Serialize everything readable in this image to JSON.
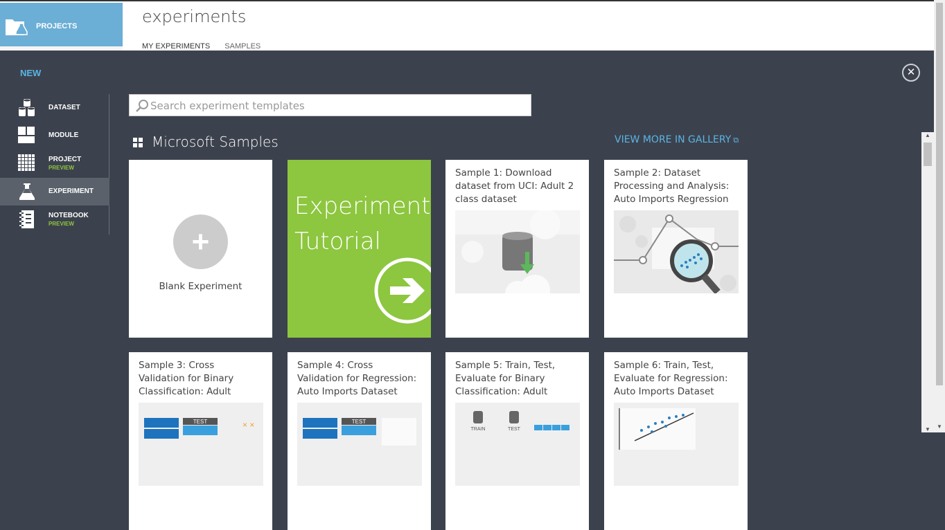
{
  "app": {
    "tile_label": "PROJECTS",
    "page_title": "experiments",
    "tabs": [
      {
        "label": "MY EXPERIMENTS"
      },
      {
        "label": "SAMPLES"
      }
    ]
  },
  "overlay": {
    "new_label": "NEW",
    "close_glyph": "✕",
    "nav": [
      {
        "label": "DATASET",
        "sub": "",
        "icon": "dataset-icon"
      },
      {
        "label": "MODULE",
        "sub": "",
        "icon": "module-icon"
      },
      {
        "label": "PROJECT",
        "sub": "PREVIEW",
        "icon": "project-grid-icon"
      },
      {
        "label": "EXPERIMENT",
        "sub": "",
        "icon": "flask-icon",
        "active": true
      },
      {
        "label": "NOTEBOOK",
        "sub": "PREVIEW",
        "icon": "notebook-icon"
      }
    ],
    "search": {
      "placeholder": "Search experiment templates",
      "value": ""
    },
    "section_title": "Microsoft Samples",
    "gallery_link": "VIEW MORE IN GALLERY",
    "cards": [
      {
        "title": "Blank Experiment",
        "plus": "+"
      },
      {
        "title": "Experiment Tutorial",
        "line1": "Experiment",
        "line2": "Tutorial"
      },
      {
        "title": "Sample 1: Download dataset from UCI: Adult 2 class dataset"
      },
      {
        "title": "Sample 2: Dataset Processing and Analysis: Auto Imports Regression"
      },
      {
        "title": "Sample 3: Cross Validation for Binary Classification: Adult",
        "img_label": "TEST"
      },
      {
        "title": "Sample 4: Cross Validation for Regression: Auto Imports Dataset",
        "img_label": "TEST"
      },
      {
        "title": "Sample 5: Train, Test, Evaluate for Binary Classification: Adult",
        "img_label_a": "TRAIN",
        "img_label_b": "TEST"
      },
      {
        "title": "Sample 6: Train, Test, Evaluate for Regression: Auto Imports Dataset"
      }
    ]
  },
  "colors": {
    "accent_blue": "#5ab4e6",
    "tutorial_green": "#8dc63f",
    "overlay_bg": "#3c424d",
    "tile_blue": "#6baed6"
  }
}
